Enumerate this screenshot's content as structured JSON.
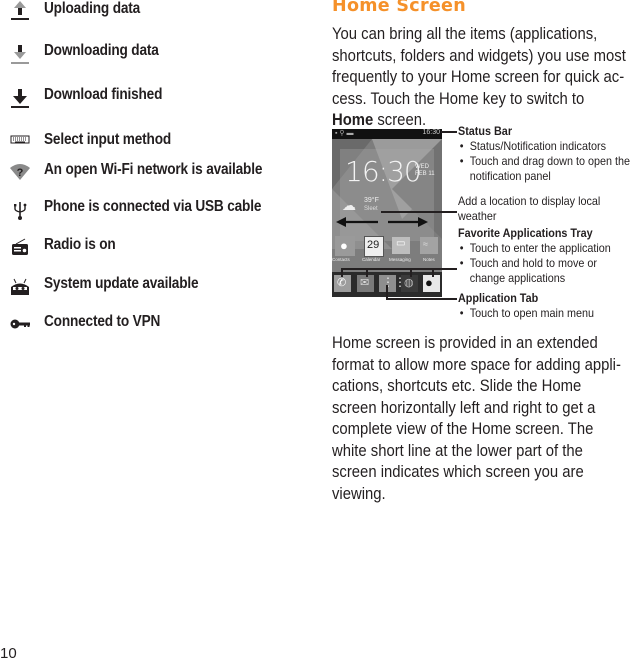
{
  "status_icons": [
    {
      "icon": "upload-arrow-icon",
      "label": "Uploading data"
    },
    {
      "icon": "download-arrow-icon",
      "label": "Downloading data"
    },
    {
      "icon": "download-finished-icon",
      "label": "Download finished"
    },
    {
      "icon": "keyboard-icon",
      "label": "Select input method"
    },
    {
      "icon": "wifi-question-icon",
      "label": "An open Wi-Fi network is available"
    },
    {
      "icon": "usb-icon",
      "label": "Phone is connected via USB cable"
    },
    {
      "icon": "radio-icon",
      "label": "Radio is on"
    },
    {
      "icon": "system-update-icon",
      "label": "System update available"
    },
    {
      "icon": "vpn-key-icon",
      "label": "Connected to VPN"
    }
  ],
  "section": {
    "title": "Home Screen",
    "intro_before_bold": "You can bring all the items (applications, shortcuts, folders and widgets) you use most frequently to your Home screen for quick ac-cess. Touch the Home key to switch to ",
    "intro_bold": "Home",
    "intro_after_bold": " screen.",
    "body": "Home screen is provided in an extended format to allow more space for adding appli-cations, shortcuts etc. Slide the Home screen horizontally left and right to get a complete view of the Home screen. The white short line at the lower part of the screen indicates which screen you are viewing."
  },
  "phone_screen": {
    "status_time": "16:30",
    "clock": "16:30",
    "date_day": "WED",
    "date": "FEB 11",
    "weather_temp": "39°F",
    "weather_desc": "Sleet",
    "apps": [
      "Contacts",
      "Calendar",
      "Messaging",
      "Notes"
    ],
    "calendar_day": "29",
    "tray": [
      "phone-icon",
      "email-icon",
      "app-grid-icon",
      "browser-icon",
      "camera-icon"
    ]
  },
  "callouts": {
    "status_bar": {
      "heading": "Status Bar",
      "bullets": [
        "Status/Notification indicators",
        "Touch and drag down to open the"
      ],
      "continuation": "notification panel"
    },
    "weather": {
      "line1": "Add a location to display local",
      "line2": "weather"
    },
    "favorites": {
      "heading": "Favorite Applications Tray",
      "bullets": [
        "Touch to enter the application",
        "Touch and hold to move or"
      ],
      "continuation": "change applications"
    },
    "app_tab": {
      "heading": "Application Tab",
      "bullets": [
        "Touch to open main menu"
      ]
    }
  },
  "page_number": "10"
}
